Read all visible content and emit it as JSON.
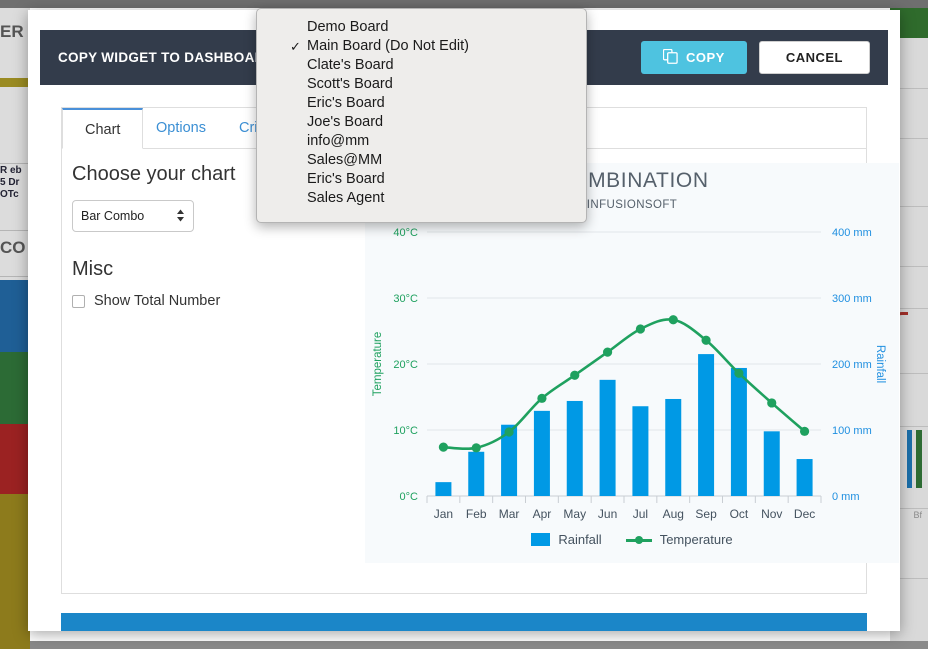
{
  "background": {
    "text_fragments": {
      "top_left": "ER",
      "block": "R eb\n5 Dr\nOTc",
      "mid_left": "CO",
      "right_small": "Bf"
    },
    "colors": {
      "olive": "#9a8b22",
      "blue": "#1f5f96",
      "green": "#2c6b35",
      "red": "#9b2222",
      "accent_blue_bar": "#1b86c8"
    }
  },
  "modal": {
    "title": "COPY WIDGET TO DASHBOARD:",
    "board_select": {
      "value": "Main Board (Do Not Edit)",
      "arrows_icon": "▲▼"
    },
    "copy_button": {
      "label": "COPY",
      "icon": "copy-icon",
      "color": "#4ec3e0"
    },
    "cancel_button": {
      "label": "CANCEL"
    }
  },
  "dropdown": {
    "selected_index": 1,
    "check_glyph": "✓",
    "items": [
      {
        "label": "Demo Board",
        "checked": false
      },
      {
        "label": "Main Board (Do Not Edit)",
        "checked": true
      },
      {
        "label": "Clate's Board",
        "checked": false
      },
      {
        "label": "Scott's Board",
        "checked": false
      },
      {
        "label": "Eric's Board",
        "checked": false
      },
      {
        "label": "Joe's Board",
        "checked": false
      },
      {
        "label": "info@mm",
        "checked": false
      },
      {
        "label": "Sales@MM",
        "checked": false
      },
      {
        "label": "Eric's Board",
        "checked": false
      },
      {
        "label": "Sales Agent",
        "checked": false
      }
    ]
  },
  "tabs": [
    {
      "label": "Chart",
      "active": true
    },
    {
      "label": "Options",
      "active": false
    },
    {
      "label": "Criteria",
      "active": false
    }
  ],
  "left_pane": {
    "choose_chart_heading": "Choose your chart",
    "chart_type_select": {
      "value": "Bar Combo",
      "arrows_icon": "▲▼"
    },
    "misc_heading": "Misc",
    "show_total_number": {
      "label": "Show Total Number",
      "checked": false
    }
  },
  "chart_data": {
    "type": "bar",
    "title": "COMBINATION",
    "subtitle": "INFUSIONSOFT",
    "categories": [
      "Jan",
      "Feb",
      "Mar",
      "Apr",
      "May",
      "Jun",
      "Jul",
      "Aug",
      "Sep",
      "Oct",
      "Nov",
      "Dec"
    ],
    "series": [
      {
        "name": "Rainfall",
        "kind": "bar",
        "axis": "right",
        "color": "#0099e5",
        "unit": "mm",
        "values": [
          21,
          67,
          108,
          129,
          144,
          176,
          136,
          147,
          215,
          194,
          98,
          56
        ]
      },
      {
        "name": "Temperature",
        "kind": "line",
        "axis": "left",
        "color": "#1fa15f",
        "unit": "°C",
        "values": [
          7.4,
          7.3,
          9.7,
          14.8,
          18.3,
          21.8,
          25.3,
          26.7,
          23.6,
          18.6,
          14.1,
          9.8
        ]
      }
    ],
    "left_axis": {
      "label": "Temperature",
      "color": "#1fa15f",
      "ticks": [
        "0°C",
        "10°C",
        "20°C",
        "30°C",
        "40°C"
      ],
      "tick_values": [
        0,
        10,
        20,
        30,
        40
      ],
      "min": 0,
      "max": 40
    },
    "right_axis": {
      "label": "Rainfall",
      "color": "#1f8fe0",
      "ticks": [
        "0 mm",
        "100 mm",
        "200 mm",
        "300 mm",
        "400 mm"
      ],
      "tick_values": [
        0,
        100,
        200,
        300,
        400
      ],
      "min": 0,
      "max": 400
    },
    "xlabel": "",
    "grid": true,
    "legend_position": "bottom",
    "legend": [
      "Rainfall",
      "Temperature"
    ]
  }
}
